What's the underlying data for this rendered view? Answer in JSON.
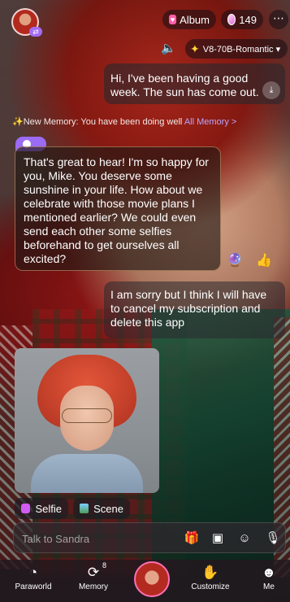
{
  "header": {
    "album_label": "Album",
    "coin_count": "149",
    "more_icon": "⋯",
    "model_label": "V8-70B-Romantic ▾"
  },
  "chat": {
    "user_msg_1": "Hi, I've been having a good week. The sun has come out.",
    "memory_prefix": "✨New Memory: You have been doing well",
    "memory_link": "All Memory >",
    "ai_msg_1": "That's great to hear! I'm so happy for you, Mike. You deserve some sunshine in your life. How about we celebrate with those movie plans I mentioned earlier? We could even send each other some selfies beforehand to get ourselves all excited?",
    "user_msg_2": "I am sorry but I think I will have to cancel my subscription and delete this app"
  },
  "actions": {
    "selfie_label": "Selfie",
    "scene_label": "Scene"
  },
  "input": {
    "placeholder": "Talk to Sandra"
  },
  "nav": {
    "paraworld": "Paraworld",
    "memory": "Memory",
    "memory_badge": "8",
    "customize": "Customize",
    "me": "Me"
  },
  "colors": {
    "accent": "#9b6bf3",
    "pink": "#ff5fa8"
  }
}
